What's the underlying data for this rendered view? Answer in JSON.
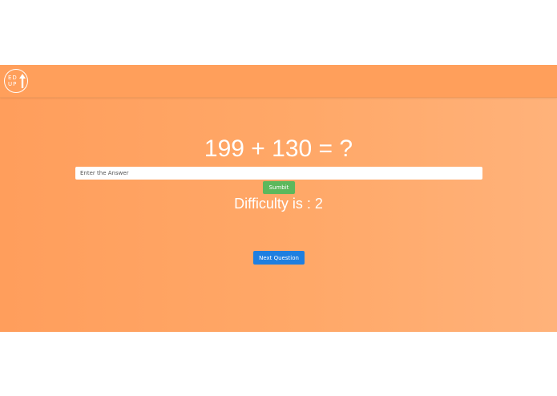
{
  "navbar": {
    "logo": {
      "line1": "ED",
      "line2": "UP",
      "icon": "up-arrow-icon"
    }
  },
  "quiz": {
    "question": "199 + 130 = ?",
    "answer_placeholder": "Enter the Answer",
    "answer_value": "",
    "submit_label": "Sumbit",
    "difficulty_text": "Difficulty is : 2",
    "next_label": "Next Question"
  },
  "colors": {
    "background": "#ff9e5c",
    "navbar": "#ff9f5b",
    "submit": "#5cb85c",
    "next": "#1f7fe0",
    "text": "#ffffff"
  }
}
